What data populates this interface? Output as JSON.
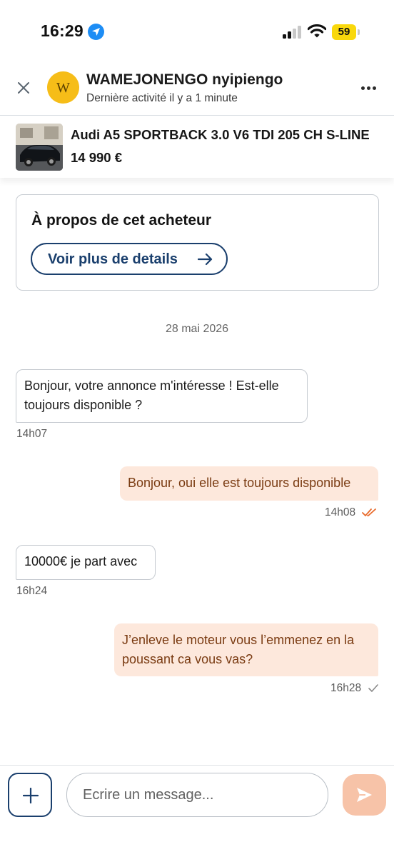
{
  "status_bar": {
    "time": "16:29",
    "battery": "59",
    "location_icon": "location-arrow-icon",
    "signal_icon": "cellular-signal-icon",
    "wifi_icon": "wifi-icon"
  },
  "header": {
    "avatar_letter": "W",
    "user_name": "WAMEJONENGO nyipiengo",
    "last_active": "Dernière activité il y a 1 minute",
    "close_icon": "close-icon",
    "more_icon": "more-dots-icon"
  },
  "listing": {
    "title": "Audi A5 SPORTBACK 3.0 V6 TDI 205 CH S-LINE",
    "price": "14 990 €"
  },
  "buyer_card": {
    "title": "À propos de cet acheteur",
    "button_label": "Voir plus de details",
    "button_icon": "arrow-right-icon"
  },
  "date_separator": "28 mai 2026",
  "messages": [
    {
      "direction": "in",
      "text": "Bonjour, votre annonce m'intéresse ! Est-elle toujours disponible ?",
      "time": "14h07"
    },
    {
      "direction": "out",
      "text": "Bonjour, oui elle est toujours disponible",
      "time": "14h08",
      "status": "read"
    },
    {
      "direction": "in",
      "text": "10000€ je part avec",
      "time": "16h24"
    },
    {
      "direction": "out",
      "text": "J’enleve le moteur vous l’emmenez en la poussant ca vous vas?",
      "time": "16h28",
      "status": "sent"
    }
  ],
  "composer": {
    "placeholder": "Ecrire un message...",
    "add_icon": "plus-icon",
    "send_icon": "send-icon"
  },
  "colors": {
    "accent_navy": "#1a3f6d",
    "outgoing_bubble": "#fde8dc",
    "outgoing_text": "#7a3b12",
    "avatar_yellow": "#f6bd18",
    "read_tick": "#e86a2a",
    "send_button": "#f7c3a8"
  }
}
